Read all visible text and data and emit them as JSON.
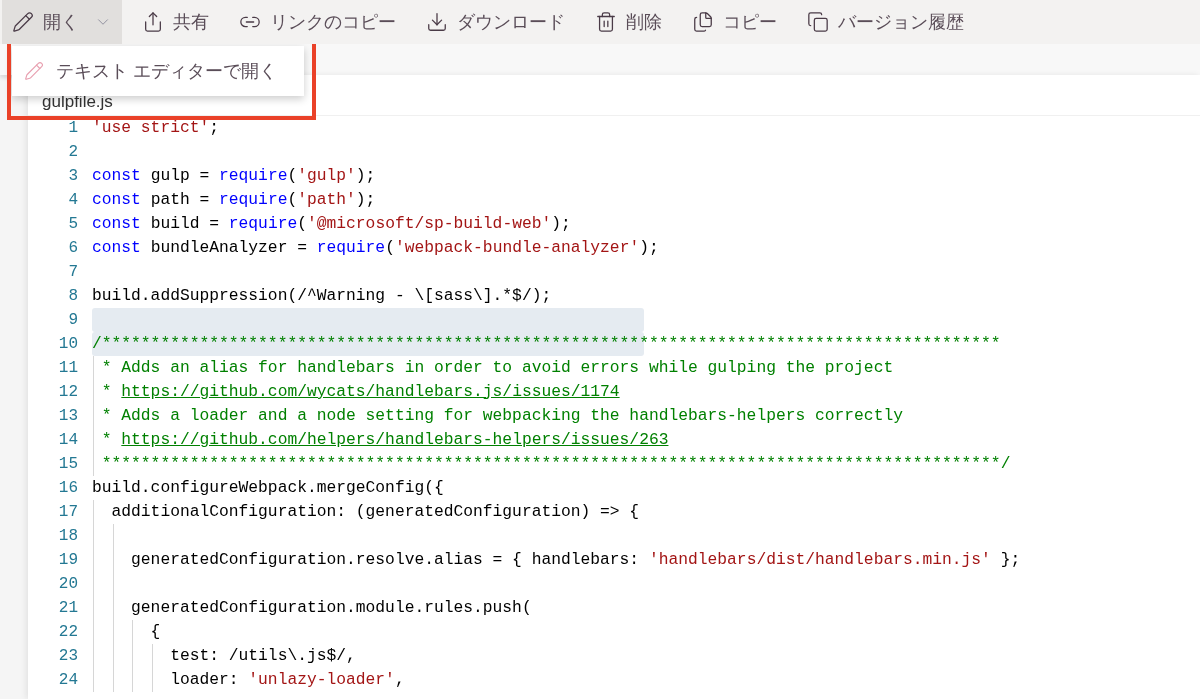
{
  "toolbar": [
    {
      "kind": "edit",
      "label": "開く",
      "dropdown": true,
      "selected": true
    },
    {
      "kind": "share",
      "label": "共有",
      "dropdown": false,
      "selected": false
    },
    {
      "kind": "link",
      "label": "リンクのコピー",
      "dropdown": false,
      "selected": false
    },
    {
      "kind": "download",
      "label": "ダウンロード",
      "dropdown": false,
      "selected": false
    },
    {
      "kind": "delete",
      "label": "削除",
      "dropdown": false,
      "selected": false
    },
    {
      "kind": "copy",
      "label": "コピー",
      "dropdown": false,
      "selected": false
    },
    {
      "kind": "versions",
      "label": "バージョン履歴",
      "dropdown": false,
      "selected": false
    }
  ],
  "open_menu": {
    "items": [
      {
        "kind": "edit",
        "label": "テキスト エディターで開く"
      }
    ]
  },
  "annotation": {
    "kind": "frame"
  },
  "file": {
    "name": "gulpfile.js"
  },
  "code_lines": [
    {
      "number": "1",
      "highlighted": false,
      "tokens": [
        {
          "kind": "string",
          "text": "'use strict'"
        },
        {
          "kind": "plain",
          "text": ";"
        }
      ]
    },
    {
      "number": "2",
      "highlighted": false
    },
    {
      "number": "3",
      "highlighted": false,
      "tokens": [
        {
          "kind": "keyword",
          "text": "const"
        },
        {
          "kind": "plain",
          "text": " gulp = "
        },
        {
          "kind": "keyword",
          "text": "require"
        },
        {
          "kind": "plain",
          "text": "("
        },
        {
          "kind": "string",
          "text": "'gulp'"
        },
        {
          "kind": "plain",
          "text": ");"
        }
      ]
    },
    {
      "number": "4",
      "highlighted": false,
      "tokens": [
        {
          "kind": "keyword",
          "text": "const"
        },
        {
          "kind": "plain",
          "text": " path = "
        },
        {
          "kind": "keyword",
          "text": "require"
        },
        {
          "kind": "plain",
          "text": "("
        },
        {
          "kind": "string",
          "text": "'path'"
        },
        {
          "kind": "plain",
          "text": ");"
        }
      ]
    },
    {
      "number": "5",
      "highlighted": false,
      "tokens": [
        {
          "kind": "keyword",
          "text": "const"
        },
        {
          "kind": "plain",
          "text": " build = "
        },
        {
          "kind": "keyword",
          "text": "require"
        },
        {
          "kind": "plain",
          "text": "("
        },
        {
          "kind": "string",
          "text": "'@microsoft/sp-build-web'"
        },
        {
          "kind": "plain",
          "text": ");"
        }
      ]
    },
    {
      "number": "6",
      "highlighted": false,
      "tokens": [
        {
          "kind": "keyword",
          "text": "const"
        },
        {
          "kind": "plain",
          "text": " bundleAnalyzer = "
        },
        {
          "kind": "keyword",
          "text": "require"
        },
        {
          "kind": "plain",
          "text": "("
        },
        {
          "kind": "string",
          "text": "'webpack-bundle-analyzer'"
        },
        {
          "kind": "plain",
          "text": ");"
        }
      ]
    },
    {
      "number": "7",
      "highlighted": false
    },
    {
      "number": "8",
      "highlighted": false,
      "tokens": [
        {
          "kind": "plain",
          "text": "build.addSuppression(/^Warning - \\[sass\\].*$/);"
        }
      ]
    },
    {
      "number": "9",
      "highlighted": true
    },
    {
      "number": "10",
      "highlighted": true,
      "tokens": [
        {
          "kind": "comment",
          "text": "/********************************************************************************************"
        }
      ]
    },
    {
      "number": "11",
      "highlighted": false,
      "tokens": [
        {
          "kind": "comment",
          "text": " * Adds an alias for handlebars in order to avoid errors while gulping the project"
        }
      ]
    },
    {
      "number": "12",
      "highlighted": false,
      "tokens": [
        {
          "kind": "comment",
          "text": " * "
        },
        {
          "kind": "link",
          "text": "https://github.com/wycats/handlebars.js/issues/1174"
        }
      ]
    },
    {
      "number": "13",
      "highlighted": false,
      "tokens": [
        {
          "kind": "comment",
          "text": " * Adds a loader and a node setting for webpacking the handlebars-helpers correctly"
        }
      ]
    },
    {
      "number": "14",
      "highlighted": false,
      "tokens": [
        {
          "kind": "comment",
          "text": " * "
        },
        {
          "kind": "link",
          "text": "https://github.com/helpers/handlebars-helpers/issues/263"
        }
      ]
    },
    {
      "number": "15",
      "highlighted": false,
      "tokens": [
        {
          "kind": "comment",
          "text": " ********************************************************************************************/"
        }
      ]
    },
    {
      "number": "16",
      "highlighted": false,
      "tokens": [
        {
          "kind": "plain",
          "text": "build.configureWebpack.mergeConfig({"
        }
      ]
    },
    {
      "number": "17",
      "highlighted": false,
      "tokens": [
        {
          "kind": "plain",
          "text": "  additionalConfiguration: (generatedConfiguration) => {"
        }
      ]
    },
    {
      "number": "18",
      "highlighted": false
    },
    {
      "number": "19",
      "highlighted": false,
      "tokens": [
        {
          "kind": "plain",
          "text": "    generatedConfiguration.resolve.alias = { handlebars: "
        },
        {
          "kind": "string",
          "text": "'handlebars/dist/handlebars.min.js'"
        },
        {
          "kind": "plain",
          "text": " };"
        }
      ]
    },
    {
      "number": "20",
      "highlighted": false
    },
    {
      "number": "21",
      "highlighted": false,
      "tokens": [
        {
          "kind": "plain",
          "text": "    generatedConfiguration.module.rules.push("
        }
      ]
    },
    {
      "number": "22",
      "highlighted": false,
      "tokens": [
        {
          "kind": "plain",
          "text": "      {"
        }
      ]
    },
    {
      "number": "23",
      "highlighted": false,
      "tokens": [
        {
          "kind": "plain",
          "text": "        test: /utils\\.js$/,"
        }
      ]
    },
    {
      "number": "24",
      "highlighted": false,
      "tokens": [
        {
          "kind": "plain",
          "text": "        loader: "
        },
        {
          "kind": "string",
          "text": "'unlazy-loader'"
        },
        {
          "kind": "plain",
          "text": ","
        }
      ]
    }
  ]
}
